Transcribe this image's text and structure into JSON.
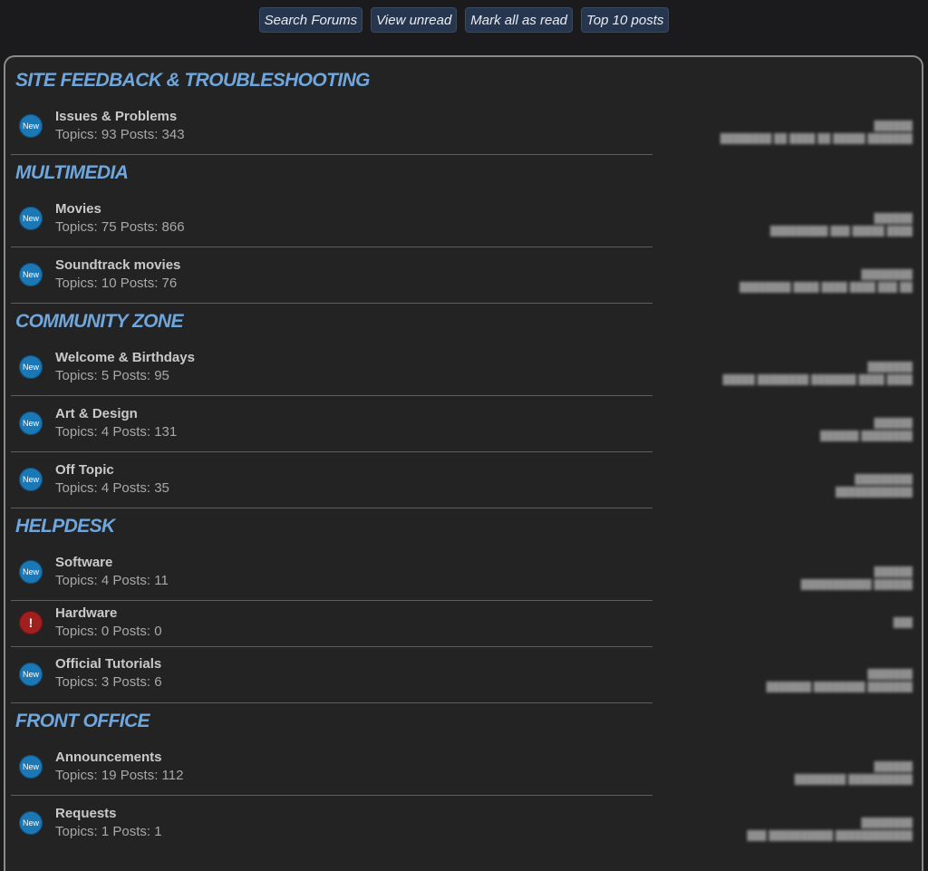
{
  "nav": {
    "buttons": [
      {
        "label": "Search Forums"
      },
      {
        "label": "View unread"
      },
      {
        "label": "Mark all as read"
      },
      {
        "label": "Top 10 posts"
      }
    ]
  },
  "categories": [
    {
      "name": "SITE FEEDBACK & TROUBLESHOOTING"
    },
    {
      "name": "MULTIMEDIA"
    },
    {
      "name": "COMMUNITY ZONE"
    },
    {
      "name": "HELPDESK"
    },
    {
      "name": "FRONT OFFICE"
    }
  ],
  "forums": [
    {
      "title": "Issues & Problems",
      "stats": "Topics: 93 Posts: 343",
      "icon": "New"
    },
    {
      "title": "Movies",
      "stats": "Topics: 75 Posts: 866",
      "icon": "New"
    },
    {
      "title": "Soundtrack movies",
      "stats": "Topics: 10 Posts: 76",
      "icon": "New"
    },
    {
      "title": "Welcome & Birthdays",
      "stats": "Topics: 5 Posts: 95",
      "icon": "New"
    },
    {
      "title": "Art & Design",
      "stats": "Topics: 4 Posts: 131",
      "icon": "New"
    },
    {
      "title": "Off Topic",
      "stats": "Topics: 4 Posts: 35",
      "icon": "New"
    },
    {
      "title": "Software",
      "stats": "Topics: 4 Posts: 11",
      "icon": "New"
    },
    {
      "title": "Hardware",
      "stats": "Topics: 0 Posts: 0",
      "icon": "!"
    },
    {
      "title": "Official Tutorials",
      "stats": "Topics: 3 Posts: 6",
      "icon": "New"
    },
    {
      "title": "Announcements",
      "stats": "Topics: 19 Posts: 112",
      "icon": "New"
    },
    {
      "title": "Requests",
      "stats": "Topics: 1 Posts: 1",
      "icon": "New"
    }
  ],
  "colors": {
    "accent": "#6fa6dc",
    "new_icon": "#1c78b4",
    "alert_icon": "#a01f1f",
    "nav_button": "#27364f"
  }
}
